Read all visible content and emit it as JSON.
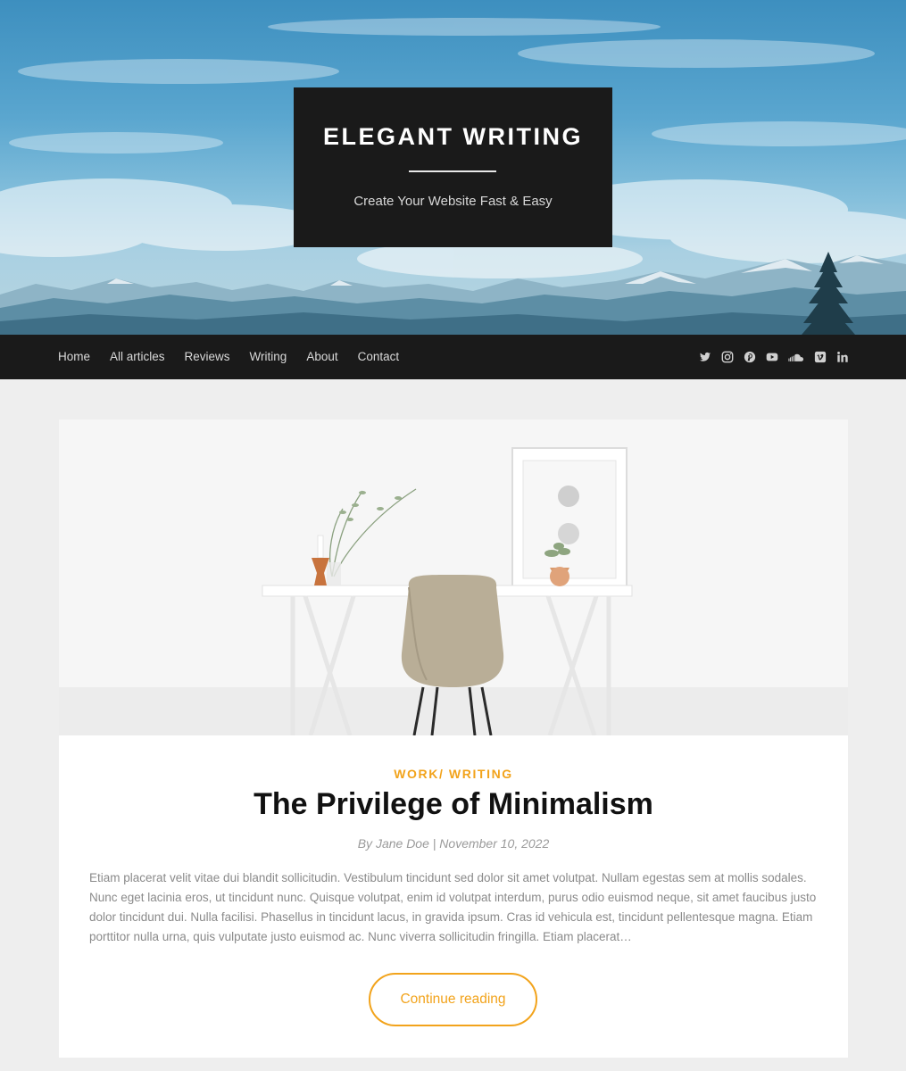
{
  "header": {
    "site_title": "ELEGANT WRITING",
    "tagline": "Create Your Website Fast & Easy"
  },
  "nav": {
    "items": [
      {
        "label": "Home"
      },
      {
        "label": "All articles"
      },
      {
        "label": "Reviews"
      },
      {
        "label": "Writing"
      },
      {
        "label": "About"
      },
      {
        "label": "Contact"
      }
    ],
    "social_icons": [
      "twitter-icon",
      "instagram-icon",
      "pinterest-icon",
      "youtube-icon",
      "soundcloud-icon",
      "vimeo-icon",
      "linkedin-icon"
    ]
  },
  "post": {
    "category_1": "WORK",
    "category_sep": "/ ",
    "category_2": "WRITING",
    "title": "The Privilege of Minimalism",
    "meta": "By Jane Doe | November 10, 2022",
    "excerpt": "Etiam placerat velit vitae dui blandit sollicitudin. Vestibulum tincidunt sed dolor sit amet volutpat. Nullam egestas sem at mollis sodales. Nunc eget lacinia eros, ut tincidunt nunc. Quisque volutpat, enim id volutpat interdum, purus odio euismod neque, sit amet faucibus justo dolor tincidunt dui. Nulla facilisi. Phasellus in tincidunt lacus, in gravida ipsum. Cras id vehicula est, tincidunt pellentesque magna. Etiam porttitor nulla urna, quis vulputate justo euismod ac. Nunc viverra sollicitudin fringilla. Etiam placerat…",
    "continue_label": "Continue reading"
  },
  "colors": {
    "accent": "#f2a31b",
    "dark": "#1a1a1a",
    "page_bg": "#eeeeee"
  }
}
